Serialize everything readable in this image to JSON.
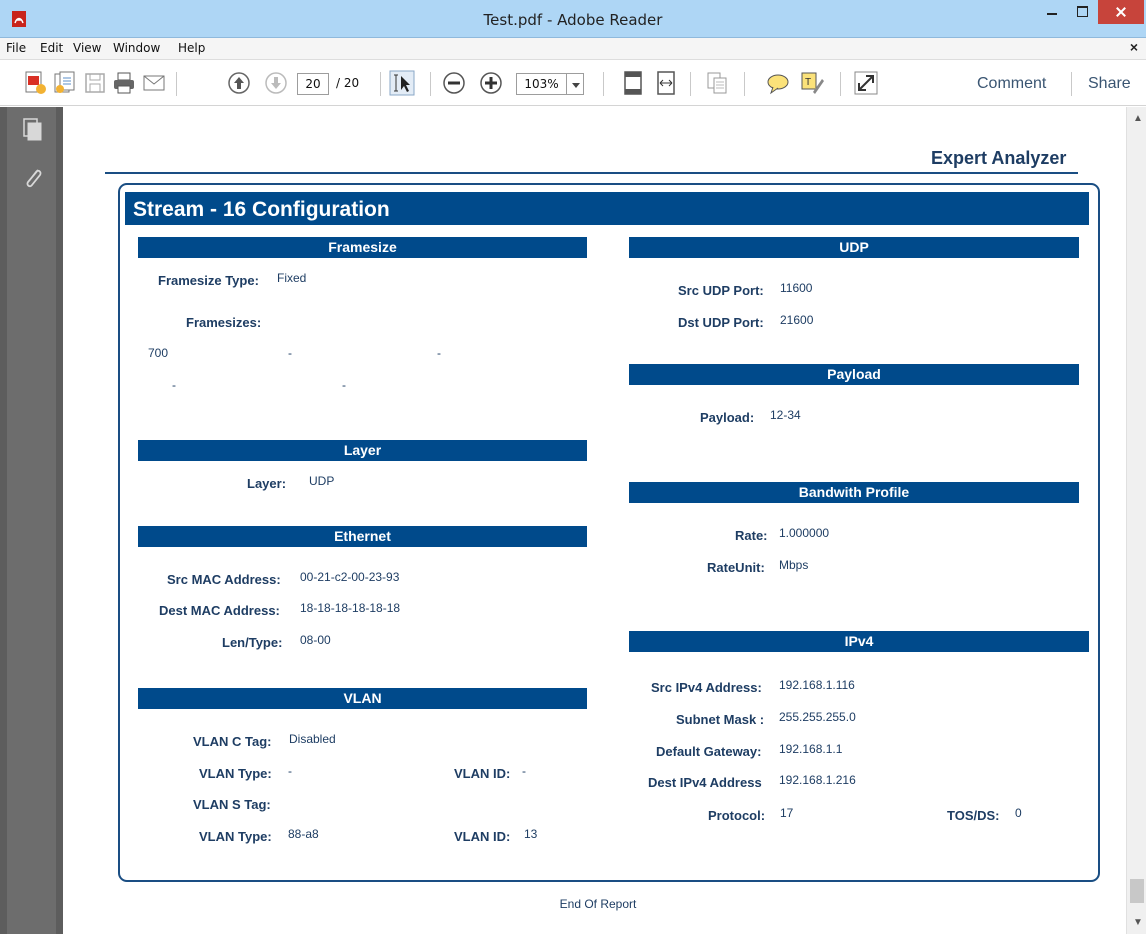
{
  "window": {
    "title": "Test.pdf - Adobe Reader"
  },
  "menu": {
    "items": [
      "File",
      "Edit",
      "View",
      "Window",
      "Help"
    ],
    "close_glyph": "×"
  },
  "toolbar": {
    "page_current": "20",
    "page_total": "/ 20",
    "zoom": "103%",
    "comment_label": "Comment",
    "share_label": "Share",
    "icons": [
      "create-pdf-icon",
      "combine-icon",
      "save-icon",
      "print-icon",
      "email-icon",
      "prev-page-icon",
      "next-page-icon",
      "select-tool-icon",
      "zoom-out-icon",
      "zoom-in-icon",
      "fit-page-icon",
      "fit-width-icon",
      "copy-icon",
      "sticky-note-icon",
      "highlight-icon",
      "fullscreen-icon"
    ]
  },
  "report": {
    "header": "Expert Analyzer",
    "title": "Stream - 16  Configuration",
    "footer": "End Of Report",
    "framesize": {
      "heading": "Framesize",
      "type_label": "Framesize Type:",
      "type_value": "Fixed",
      "sizes_label": "Framesizes:",
      "sizes": [
        "700",
        "-",
        "-",
        "-",
        "-"
      ]
    },
    "layer": {
      "heading": "Layer",
      "label": "Layer:",
      "value": "UDP"
    },
    "ethernet": {
      "heading": "Ethernet",
      "src_mac_label": "Src MAC Address:",
      "src_mac_value": "00-21-c2-00-23-93",
      "dest_mac_label": "Dest MAC Address:",
      "dest_mac_value": "18-18-18-18-18-18",
      "len_type_label": "Len/Type:",
      "len_type_value": "08-00"
    },
    "vlan": {
      "heading": "VLAN",
      "c_tag_label": "VLAN C Tag:",
      "c_tag_value": "Disabled",
      "c_type_label": "VLAN Type:",
      "c_type_value": "-",
      "c_id_label": "VLAN ID:",
      "c_id_value": "-",
      "s_tag_label": "VLAN S Tag:",
      "s_type_label": "VLAN Type:",
      "s_type_value": "88-a8",
      "s_id_label": "VLAN ID:",
      "s_id_value": "13"
    },
    "udp": {
      "heading": "UDP",
      "src_port_label": "Src UDP Port:",
      "src_port_value": "11600",
      "dst_port_label": "Dst UDP Port:",
      "dst_port_value": "21600"
    },
    "payload": {
      "heading": "Payload",
      "label": "Payload:",
      "value": "12-34"
    },
    "bandwidth": {
      "heading": "Bandwith Profile",
      "rate_label": "Rate:",
      "rate_value": "1.000000",
      "unit_label": "RateUnit:",
      "unit_value": "Mbps"
    },
    "ipv4": {
      "heading": "IPv4",
      "src_label": "Src IPv4 Address:",
      "src_value": "192.168.1.116",
      "mask_label": "Subnet Mask :",
      "mask_value": "255.255.255.0",
      "gateway_label": "Default Gateway:",
      "gateway_value": "192.168.1.1",
      "dest_label": "Dest IPv4 Address",
      "dest_value": "192.168.1.216",
      "protocol_label": "Protocol:",
      "protocol_value": "17",
      "tos_label": "TOS/DS:",
      "tos_value": "0"
    }
  },
  "colors": {
    "section_blue": "#004a8b",
    "text_navy": "#1e3d63",
    "titlebar": "#aed6f5",
    "close_red": "#c7443b"
  }
}
